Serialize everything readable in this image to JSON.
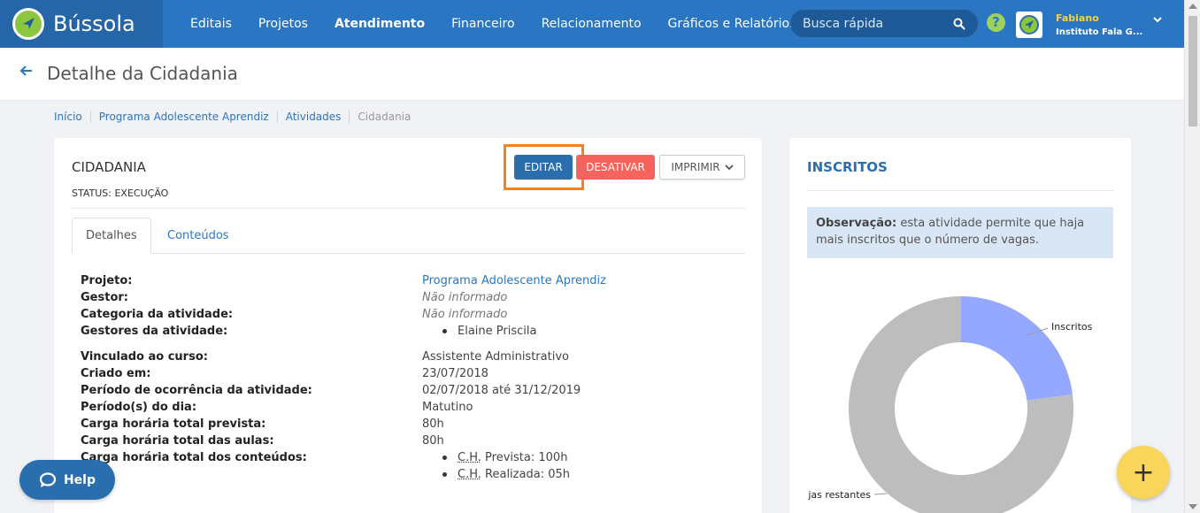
{
  "app": {
    "name": "Bússola"
  },
  "nav": {
    "items": [
      {
        "label": "Editais",
        "active": false
      },
      {
        "label": "Projetos",
        "active": false
      },
      {
        "label": "Atendimento",
        "active": true
      },
      {
        "label": "Financeiro",
        "active": false
      },
      {
        "label": "Relacionamento",
        "active": false
      },
      {
        "label": "Gráficos e Relatórios",
        "active": false
      }
    ],
    "search_placeholder": "Busca rápida",
    "help_glyph": "?"
  },
  "user": {
    "name": "Fabiano",
    "org": "Instituto Fala G..."
  },
  "page": {
    "title": "Detalhe da Cidadania"
  },
  "breadcrumb": [
    "Início",
    "Programa Adolescente Aprendiz",
    "Atividades",
    "Cidadania"
  ],
  "activity": {
    "title": "CIDADANIA",
    "status_label": "STATUS:",
    "status_value": "EXECUÇÃO",
    "buttons": {
      "edit": "EDITAR",
      "deactivate": "DESATIVAR",
      "print": "IMPRIMIR"
    }
  },
  "tabs": {
    "details": "Detalhes",
    "contents": "Conteúdos"
  },
  "details": {
    "projeto": {
      "label": "Projeto:",
      "value": "Programa Adolescente Aprendiz"
    },
    "gestor": {
      "label": "Gestor:",
      "value": "Não informado"
    },
    "categoria": {
      "label": "Categoria da atividade:",
      "value": "Não informado"
    },
    "gestores": {
      "label": "Gestores da atividade:",
      "items": [
        "Elaine Priscila"
      ]
    },
    "curso": {
      "label": "Vinculado ao curso:",
      "value": "Assistente Administrativo"
    },
    "criado": {
      "label": "Criado em:",
      "value": "23/07/2018"
    },
    "periodo_ocorrencia": {
      "label": "Período de ocorrência da atividade:",
      "value": "02/07/2018 até 31/12/2019"
    },
    "periodo_dia": {
      "label": "Período(s) do dia:",
      "value": "Matutino"
    },
    "carga_prevista": {
      "label": "Carga horária total prevista:",
      "value": "80h"
    },
    "carga_aulas": {
      "label": "Carga horária total das aulas:",
      "value": "80h"
    },
    "carga_conteudos": {
      "label": "Carga horária total dos conteúdos:",
      "abbr": "C.H.",
      "prevista_label": "Prevista:",
      "prevista_value": "100h",
      "realizada_label": "Realizada:",
      "realizada_value": "05h"
    }
  },
  "side": {
    "title": "INSCRITOS",
    "note_bold": "Observação:",
    "note_text": " esta atividade permite que haja mais inscritos que o número de vagas."
  },
  "chart_data": {
    "type": "pie",
    "donut": true,
    "slices": [
      {
        "label": "Inscritos",
        "value": 0.23,
        "color": "#95a8ff"
      },
      {
        "label": "jas restantes",
        "value": 0.77,
        "color": "#bdbdbd"
      }
    ]
  },
  "help": {
    "label": "Help"
  },
  "fab": {
    "label": "+"
  }
}
